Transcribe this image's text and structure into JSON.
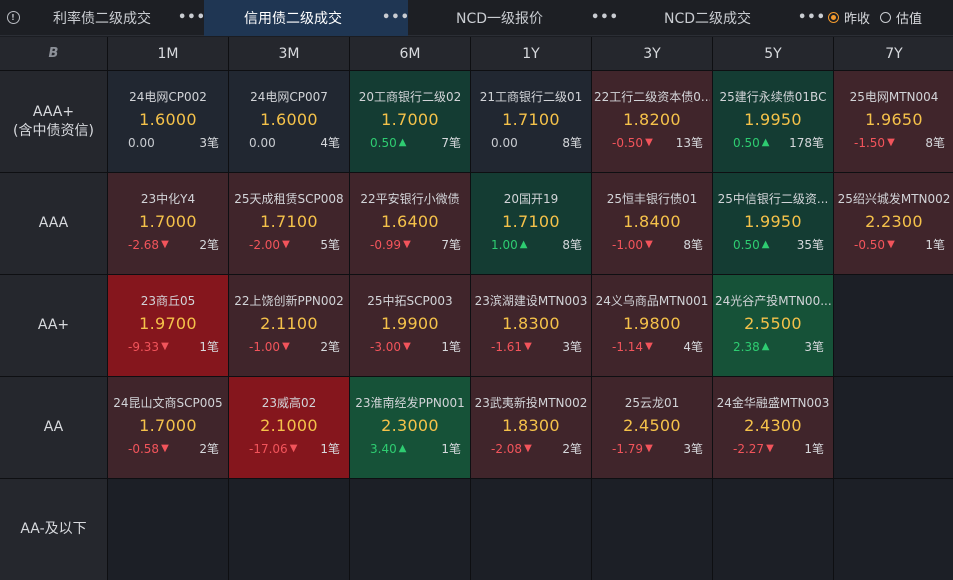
{
  "tabs": [
    {
      "label": "利率债二级成交",
      "active": false
    },
    {
      "label": "信用债二级成交",
      "active": true
    },
    {
      "label": "NCD一级报价",
      "active": false
    },
    {
      "label": "NCD二级成交",
      "active": false
    }
  ],
  "tab_more": "•••",
  "radio": {
    "options": [
      {
        "label": "昨收",
        "selected": true
      },
      {
        "label": "估值",
        "selected": false
      }
    ]
  },
  "table": {
    "corner_logo": "B",
    "columns": [
      "1M",
      "3M",
      "6M",
      "1Y",
      "3Y",
      "5Y",
      "7Y"
    ],
    "count_suffix": "笔",
    "rows": [
      {
        "label_lines": [
          "AAA+",
          "(含中债资信)"
        ],
        "cells": [
          {
            "name": "24电网CP002",
            "yield": "1.6000",
            "change": "0.00",
            "dir": "zero",
            "count": "3",
            "tone": "neutral"
          },
          {
            "name": "24电网CP007",
            "yield": "1.6000",
            "change": "0.00",
            "dir": "zero",
            "count": "4",
            "tone": "neutral"
          },
          {
            "name": "20工商银行二级02",
            "yield": "1.7000",
            "change": "0.50",
            "dir": "up",
            "count": "7",
            "tone": "up1"
          },
          {
            "name": "21工商银行二级01",
            "yield": "1.7100",
            "change": "0.00",
            "dir": "zero",
            "count": "8",
            "tone": "neutral"
          },
          {
            "name": "22工行二级资本债0...",
            "yield": "1.8200",
            "change": "-0.50",
            "dir": "down",
            "count": "13",
            "tone": "down1"
          },
          {
            "name": "25建行永续债01BC",
            "yield": "1.9950",
            "change": "0.50",
            "dir": "up",
            "count": "178",
            "tone": "up1"
          },
          {
            "name": "25电网MTN004",
            "yield": "1.9650",
            "change": "-1.50",
            "dir": "down",
            "count": "8",
            "tone": "down1"
          }
        ]
      },
      {
        "label_lines": [
          "AAA"
        ],
        "cells": [
          {
            "name": "23中化Y4",
            "yield": "1.7000",
            "change": "-2.68",
            "dir": "down",
            "count": "2",
            "tone": "down1"
          },
          {
            "name": "25天成租赁SCP008",
            "yield": "1.7100",
            "change": "-2.00",
            "dir": "down",
            "count": "5",
            "tone": "down1"
          },
          {
            "name": "22平安银行小微债",
            "yield": "1.6400",
            "change": "-0.99",
            "dir": "down",
            "count": "7",
            "tone": "down1"
          },
          {
            "name": "20国开19",
            "yield": "1.7100",
            "change": "1.00",
            "dir": "up",
            "count": "8",
            "tone": "up1"
          },
          {
            "name": "25恒丰银行债01",
            "yield": "1.8400",
            "change": "-1.00",
            "dir": "down",
            "count": "8",
            "tone": "down1"
          },
          {
            "name": "25中信银行二级资...",
            "yield": "1.9950",
            "change": "0.50",
            "dir": "up",
            "count": "35",
            "tone": "up1"
          },
          {
            "name": "25绍兴城发MTN002",
            "yield": "2.2300",
            "change": "-0.50",
            "dir": "down",
            "count": "1",
            "tone": "down1"
          }
        ]
      },
      {
        "label_lines": [
          "AA+"
        ],
        "cells": [
          {
            "name": "23商丘05",
            "yield": "1.9700",
            "change": "-9.33",
            "dir": "down",
            "count": "1",
            "tone": "down3"
          },
          {
            "name": "22上饶创新PPN002",
            "yield": "2.1100",
            "change": "-1.00",
            "dir": "down",
            "count": "2",
            "tone": "down1"
          },
          {
            "name": "25中拓SCP003",
            "yield": "1.9900",
            "change": "-3.00",
            "dir": "down",
            "count": "1",
            "tone": "down1"
          },
          {
            "name": "23滨湖建设MTN003",
            "yield": "1.8300",
            "change": "-1.61",
            "dir": "down",
            "count": "3",
            "tone": "down1"
          },
          {
            "name": "24义乌商品MTN001",
            "yield": "1.9800",
            "change": "-1.14",
            "dir": "down",
            "count": "4",
            "tone": "down1"
          },
          {
            "name": "24光谷产投MTN00...",
            "yield": "2.5500",
            "change": "2.38",
            "dir": "up",
            "count": "3",
            "tone": "up2"
          },
          null
        ]
      },
      {
        "label_lines": [
          "AA"
        ],
        "cells": [
          {
            "name": "24昆山文商SCP005",
            "yield": "1.7000",
            "change": "-0.58",
            "dir": "down",
            "count": "2",
            "tone": "down1"
          },
          {
            "name": "23威高02",
            "yield": "2.1000",
            "change": "-17.06",
            "dir": "down",
            "count": "1",
            "tone": "down3"
          },
          {
            "name": "23淮南经发PPN001",
            "yield": "2.3000",
            "change": "3.40",
            "dir": "up",
            "count": "1",
            "tone": "up2"
          },
          {
            "name": "23武夷新投MTN002",
            "yield": "1.8300",
            "change": "-2.08",
            "dir": "down",
            "count": "2",
            "tone": "down1"
          },
          {
            "name": "25云龙01",
            "yield": "2.4500",
            "change": "-1.79",
            "dir": "down",
            "count": "3",
            "tone": "down1"
          },
          {
            "name": "24金华融盛MTN003",
            "yield": "2.4300",
            "change": "-2.27",
            "dir": "down",
            "count": "1",
            "tone": "down1"
          },
          null
        ]
      },
      {
        "label_lines": [
          "AA-及以下"
        ],
        "cells": [
          null,
          null,
          null,
          null,
          null,
          null,
          null
        ]
      }
    ]
  },
  "colors": {
    "yield": "#f5c24a",
    "negative": "#f2545b",
    "positive": "#2ecc71",
    "active_tab": "#1f3653",
    "radio_selected": "#f39a2e"
  }
}
